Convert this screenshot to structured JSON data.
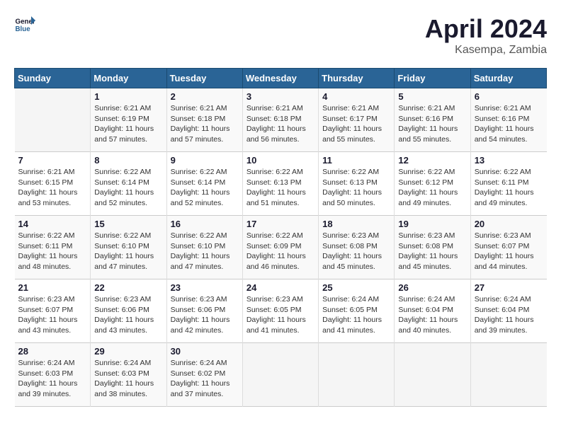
{
  "header": {
    "logo_line1": "General",
    "logo_line2": "Blue",
    "month_title": "April 2024",
    "subtitle": "Kasempa, Zambia"
  },
  "days_of_week": [
    "Sunday",
    "Monday",
    "Tuesday",
    "Wednesday",
    "Thursday",
    "Friday",
    "Saturday"
  ],
  "weeks": [
    [
      {
        "day": "",
        "info": ""
      },
      {
        "day": "1",
        "info": "Sunrise: 6:21 AM\nSunset: 6:19 PM\nDaylight: 11 hours\nand 57 minutes."
      },
      {
        "day": "2",
        "info": "Sunrise: 6:21 AM\nSunset: 6:18 PM\nDaylight: 11 hours\nand 57 minutes."
      },
      {
        "day": "3",
        "info": "Sunrise: 6:21 AM\nSunset: 6:18 PM\nDaylight: 11 hours\nand 56 minutes."
      },
      {
        "day": "4",
        "info": "Sunrise: 6:21 AM\nSunset: 6:17 PM\nDaylight: 11 hours\nand 55 minutes."
      },
      {
        "day": "5",
        "info": "Sunrise: 6:21 AM\nSunset: 6:16 PM\nDaylight: 11 hours\nand 55 minutes."
      },
      {
        "day": "6",
        "info": "Sunrise: 6:21 AM\nSunset: 6:16 PM\nDaylight: 11 hours\nand 54 minutes."
      }
    ],
    [
      {
        "day": "7",
        "info": "Sunrise: 6:21 AM\nSunset: 6:15 PM\nDaylight: 11 hours\nand 53 minutes."
      },
      {
        "day": "8",
        "info": "Sunrise: 6:22 AM\nSunset: 6:14 PM\nDaylight: 11 hours\nand 52 minutes."
      },
      {
        "day": "9",
        "info": "Sunrise: 6:22 AM\nSunset: 6:14 PM\nDaylight: 11 hours\nand 52 minutes."
      },
      {
        "day": "10",
        "info": "Sunrise: 6:22 AM\nSunset: 6:13 PM\nDaylight: 11 hours\nand 51 minutes."
      },
      {
        "day": "11",
        "info": "Sunrise: 6:22 AM\nSunset: 6:13 PM\nDaylight: 11 hours\nand 50 minutes."
      },
      {
        "day": "12",
        "info": "Sunrise: 6:22 AM\nSunset: 6:12 PM\nDaylight: 11 hours\nand 49 minutes."
      },
      {
        "day": "13",
        "info": "Sunrise: 6:22 AM\nSunset: 6:11 PM\nDaylight: 11 hours\nand 49 minutes."
      }
    ],
    [
      {
        "day": "14",
        "info": "Sunrise: 6:22 AM\nSunset: 6:11 PM\nDaylight: 11 hours\nand 48 minutes."
      },
      {
        "day": "15",
        "info": "Sunrise: 6:22 AM\nSunset: 6:10 PM\nDaylight: 11 hours\nand 47 minutes."
      },
      {
        "day": "16",
        "info": "Sunrise: 6:22 AM\nSunset: 6:10 PM\nDaylight: 11 hours\nand 47 minutes."
      },
      {
        "day": "17",
        "info": "Sunrise: 6:22 AM\nSunset: 6:09 PM\nDaylight: 11 hours\nand 46 minutes."
      },
      {
        "day": "18",
        "info": "Sunrise: 6:23 AM\nSunset: 6:08 PM\nDaylight: 11 hours\nand 45 minutes."
      },
      {
        "day": "19",
        "info": "Sunrise: 6:23 AM\nSunset: 6:08 PM\nDaylight: 11 hours\nand 45 minutes."
      },
      {
        "day": "20",
        "info": "Sunrise: 6:23 AM\nSunset: 6:07 PM\nDaylight: 11 hours\nand 44 minutes."
      }
    ],
    [
      {
        "day": "21",
        "info": "Sunrise: 6:23 AM\nSunset: 6:07 PM\nDaylight: 11 hours\nand 43 minutes."
      },
      {
        "day": "22",
        "info": "Sunrise: 6:23 AM\nSunset: 6:06 PM\nDaylight: 11 hours\nand 43 minutes."
      },
      {
        "day": "23",
        "info": "Sunrise: 6:23 AM\nSunset: 6:06 PM\nDaylight: 11 hours\nand 42 minutes."
      },
      {
        "day": "24",
        "info": "Sunrise: 6:23 AM\nSunset: 6:05 PM\nDaylight: 11 hours\nand 41 minutes."
      },
      {
        "day": "25",
        "info": "Sunrise: 6:24 AM\nSunset: 6:05 PM\nDaylight: 11 hours\nand 41 minutes."
      },
      {
        "day": "26",
        "info": "Sunrise: 6:24 AM\nSunset: 6:04 PM\nDaylight: 11 hours\nand 40 minutes."
      },
      {
        "day": "27",
        "info": "Sunrise: 6:24 AM\nSunset: 6:04 PM\nDaylight: 11 hours\nand 39 minutes."
      }
    ],
    [
      {
        "day": "28",
        "info": "Sunrise: 6:24 AM\nSunset: 6:03 PM\nDaylight: 11 hours\nand 39 minutes."
      },
      {
        "day": "29",
        "info": "Sunrise: 6:24 AM\nSunset: 6:03 PM\nDaylight: 11 hours\nand 38 minutes."
      },
      {
        "day": "30",
        "info": "Sunrise: 6:24 AM\nSunset: 6:02 PM\nDaylight: 11 hours\nand 37 minutes."
      },
      {
        "day": "",
        "info": ""
      },
      {
        "day": "",
        "info": ""
      },
      {
        "day": "",
        "info": ""
      },
      {
        "day": "",
        "info": ""
      }
    ]
  ]
}
